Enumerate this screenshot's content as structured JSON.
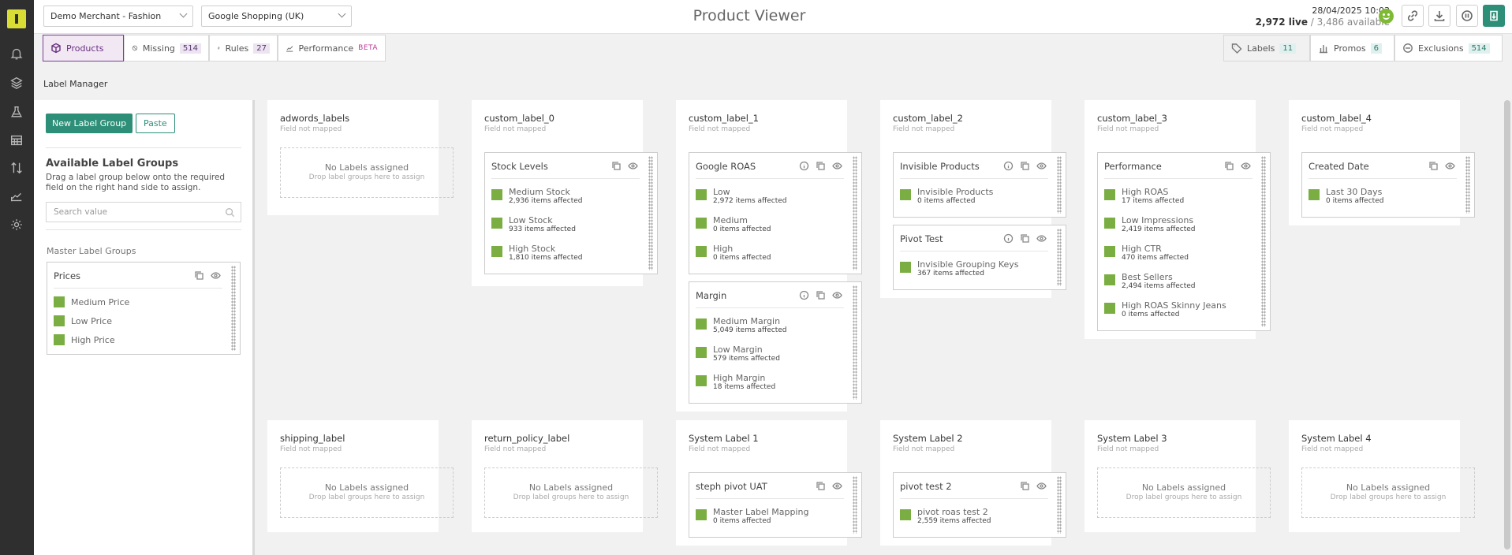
{
  "header": {
    "merchant": "Demo Merchant - Fashion",
    "channel": "Google Shopping (UK)",
    "title": "Product Viewer",
    "datetime": "28/04/2025 10:03",
    "live": "2,972 live",
    "available": " / 3,486 available"
  },
  "tabs": {
    "products": "Products",
    "missing": "Missing",
    "missing_count": "514",
    "rules": "Rules",
    "rules_count": "27",
    "performance": "Performance",
    "performance_badge": "BETA",
    "labels": "Labels",
    "labels_count": "11",
    "promos": "Promos",
    "promos_count": "6",
    "exclusions": "Exclusions",
    "exclusions_count": "514"
  },
  "sidebar_icons": [
    "bell-icon",
    "layers-icon",
    "flask-icon",
    "grid-icon",
    "sort-icon",
    "chart-icon",
    "gear-icon"
  ],
  "label_manager": {
    "title": "Label Manager",
    "new_group": "New Label Group",
    "paste": "Paste",
    "available_title": "Available Label Groups",
    "available_desc": "Drag a label group below onto the required field on the right hand side to assign.",
    "search_placeholder": "Search value",
    "master_title": "Master Label Groups",
    "master_group": {
      "name": "Prices",
      "items": [
        "Medium Price",
        "Low Price",
        "High Price"
      ]
    }
  },
  "empty": {
    "no_labels": "No Labels assigned",
    "drop_hint": "Drop label groups here to assign",
    "not_mapped": "Field not mapped"
  },
  "fields": [
    {
      "name": "adwords_labels",
      "groups": []
    },
    {
      "name": "custom_label_0",
      "groups": [
        {
          "name": "Stock Levels",
          "items": [
            {
              "name": "Medium Stock",
              "affected": "2,936 items affected"
            },
            {
              "name": "Low Stock",
              "affected": "933 items affected"
            },
            {
              "name": "High Stock",
              "affected": "1,810 items affected"
            }
          ]
        }
      ]
    },
    {
      "name": "custom_label_1",
      "groups": [
        {
          "name": "Google ROAS",
          "items": [
            {
              "name": "Low",
              "affected": "2,972 items affected"
            },
            {
              "name": "Medium",
              "affected": "0 items affected"
            },
            {
              "name": "High",
              "affected": "0 items affected"
            }
          ]
        },
        {
          "name": "Margin",
          "items": [
            {
              "name": "Medium Margin",
              "affected": "5,049 items affected"
            },
            {
              "name": "Low Margin",
              "affected": "579 items affected"
            },
            {
              "name": "High Margin",
              "affected": "18 items affected"
            }
          ]
        }
      ]
    },
    {
      "name": "custom_label_2",
      "groups": [
        {
          "name": "Invisible Products",
          "items": [
            {
              "name": "Invisible Products",
              "affected": "0 items affected"
            }
          ]
        },
        {
          "name": "Pivot Test",
          "items": [
            {
              "name": "Invisible Grouping Keys",
              "affected": "367 items affected"
            }
          ]
        }
      ]
    },
    {
      "name": "custom_label_3",
      "groups": [
        {
          "name": "Performance",
          "items": [
            {
              "name": "High ROAS",
              "affected": "17 items affected"
            },
            {
              "name": "Low Impressions",
              "affected": "2,419 items affected"
            },
            {
              "name": "High CTR",
              "affected": "470 items affected"
            },
            {
              "name": "Best Sellers",
              "affected": "2,494 items affected"
            },
            {
              "name": "High ROAS Skinny Jeans",
              "affected": "0 items affected"
            }
          ]
        }
      ]
    },
    {
      "name": "custom_label_4",
      "groups": [
        {
          "name": "Created Date",
          "items": [
            {
              "name": "Last 30 Days",
              "affected": "0 items affected"
            }
          ]
        }
      ]
    },
    {
      "name": "shipping_label",
      "groups": []
    },
    {
      "name": "return_policy_label",
      "groups": []
    },
    {
      "name": "System Label 1",
      "groups": [
        {
          "name": "steph pivot UAT",
          "items": [
            {
              "name": "Master Label Mapping",
              "affected": "0 items affected"
            }
          ]
        }
      ]
    },
    {
      "name": "System Label 2",
      "groups": [
        {
          "name": "pivot test 2",
          "items": [
            {
              "name": "pivot roas test 2",
              "affected": "2,559 items affected"
            }
          ]
        }
      ]
    },
    {
      "name": "System Label 3",
      "groups": []
    },
    {
      "name": "System Label 4",
      "groups": []
    }
  ],
  "colors": {
    "accent": "#2e8f79",
    "tab_active": "#7a3e90",
    "label_swatch": "#7aae43"
  }
}
